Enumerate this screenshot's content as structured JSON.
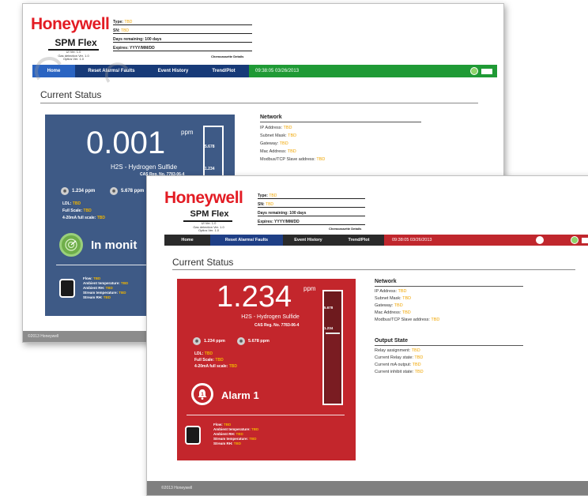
{
  "back_screen": {
    "brand": "Honeywell",
    "product": "SPM Flex",
    "versions": [
      "UI Ver. 1.0",
      "Gas detection Ver. 1.0",
      "Optics Ver. 1.0"
    ],
    "type_label": "Type:",
    "type_value": "TBD",
    "sn_label": "SN:",
    "sn_value": "TBD",
    "days_label": "Days remaining:",
    "days_value": "100 days",
    "expires_label": "Expires:",
    "expires_value": "YYYY/MM/DD",
    "change_link": "Chemcassette Details",
    "nav": {
      "home": "Home",
      "reset": "Reset Alarms/ Faults",
      "history": "Event History",
      "trend": "Trend/Plot",
      "clock": "09:38:05  03/26/2013"
    },
    "section_title": "Current Status",
    "reading": {
      "value": "0.001",
      "unit": "ppm",
      "gas": "H2S - Hydrogen Sulfide",
      "cas": "CAS Reg. No. 7783-06-4",
      "gauge_top": "5.678",
      "gauge_mid": "1.234"
    },
    "alarms": {
      "a1": "1.234 ppm",
      "a2": "5.678 ppm"
    },
    "meta": {
      "ldl_label": "LDL:",
      "ldl_value": "TBD",
      "fullscale_label": "Full Scale:",
      "fullscale_value": "TBD",
      "ma_label": "4-20mA full scale:",
      "ma_value": "TBD"
    },
    "state": "In monit",
    "env": {
      "flow_label": "Flow:",
      "flow_value": "TBD",
      "at_label": "Ambient temperature:",
      "at_value": "TBD",
      "arh_label": "Ambient RH:",
      "arh_value": "TBD",
      "st_label": "Stream temperature:",
      "st_value": "TBD",
      "srh_label": "Stream RH:",
      "srh_value": "TBD"
    },
    "network": {
      "title": "Network",
      "ip_label": "IP Address:",
      "ip_value": "TBD",
      "mask_label": "Subnet Mask:",
      "mask_value": "TBD",
      "gw_label": "Gateway:",
      "gw_value": "TBD",
      "mac_label": "Mac Address:",
      "mac_value": "TBD",
      "modbus_label": "Modbus/TCP Slave address:",
      "modbus_value": "TBD"
    },
    "footer": "©2013 Honeywell"
  },
  "front_screen": {
    "brand": "Honeywell",
    "product": "SPM Flex",
    "versions": [
      "UI Ver. 1.0",
      "Gas detection Ver. 1.0",
      "Optics Ver. 1.0"
    ],
    "type_label": "Type:",
    "type_value": "TBD",
    "sn_label": "SN:",
    "sn_value": "TBD",
    "days_label": "Days remaining:",
    "days_value": "100 days",
    "expires_label": "Expires:",
    "expires_value": "YYYY/MM/DD",
    "change_link": "Chemcassette Details",
    "nav": {
      "home": "Home",
      "reset": "Reset Alarms/ Faults",
      "history": "Event History",
      "trend": "Trend/Plot",
      "clock": "09:38:05  03/26/2013"
    },
    "section_title": "Current Status",
    "reading": {
      "value": "1.234",
      "unit": "ppm",
      "gas": "H2S - Hydrogen Sulfide",
      "cas": "CAS Reg. No. 7783-06-4",
      "gauge_top": "5.678",
      "gauge_mid": "1.234"
    },
    "alarms": {
      "a1": "1.234 ppm",
      "a2": "5.678 ppm"
    },
    "meta": {
      "ldl_label": "LDL:",
      "ldl_value": "TBD",
      "fullscale_label": "Full Scale:",
      "fullscale_value": "TBD",
      "ma_label": "4-20mA full scale:",
      "ma_value": "TBD"
    },
    "state": "Alarm 1",
    "env": {
      "flow_label": "Flow:",
      "flow_value": "TBD",
      "at_label": "Ambient temperature:",
      "at_value": "TBD",
      "arh_label": "Ambient RH:",
      "arh_value": "TBD",
      "st_label": "Stream temperature:",
      "st_value": "TBD",
      "srh_label": "Stream RH:",
      "srh_value": "TBD"
    },
    "network": {
      "title": "Network",
      "ip_label": "IP Address:",
      "ip_value": "TBD",
      "mask_label": "Subnet Mask:",
      "mask_value": "TBD",
      "gw_label": "Gateway:",
      "gw_value": "TBD",
      "mac_label": "Mac Address:",
      "mac_value": "TBD",
      "modbus_label": "Modbus/TCP Slave address:",
      "modbus_value": "TBD"
    },
    "output": {
      "title": "Output State",
      "relay_assign_label": "Relay assignment:",
      "relay_assign_value": "TBD",
      "relay_state_label": "Current Relay state:",
      "relay_state_value": "TBD",
      "ma_label": "Current mA output:",
      "ma_value": "TBD",
      "inhibit_label": "Current inhibit state:",
      "inhibit_value": "TBD"
    },
    "footer": "©2013 Honeywell"
  },
  "colors": {
    "brand_red": "#e31b23",
    "nav_back": "#173a78",
    "nav_back_ok": "#1f9a35",
    "nav_front": "#2a2a2a",
    "nav_front_alarm": "#c0272d",
    "card_blue": "#3e5a86",
    "card_red": "#c3262c",
    "tbd": "#f0a500"
  }
}
